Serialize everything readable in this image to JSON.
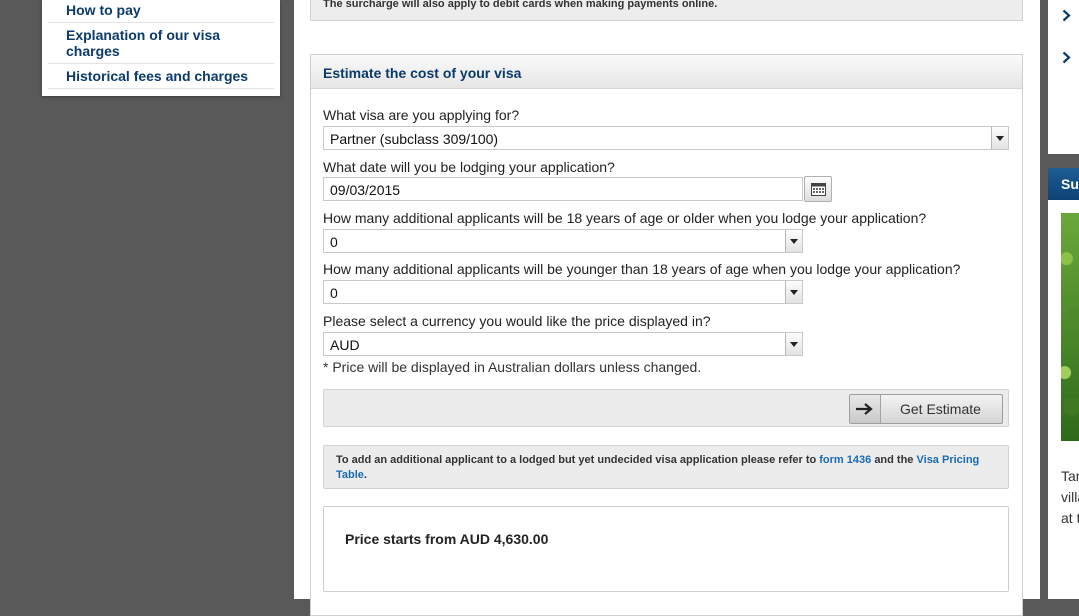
{
  "sidebar": {
    "items": [
      {
        "label": "How to pay"
      },
      {
        "label": "Explanation of our visa charges"
      },
      {
        "label": "Historical fees and charges"
      }
    ]
  },
  "notice": "The surcharge will also apply to debit cards when making payments online.",
  "estimator": {
    "title": "Estimate the cost of your visa",
    "visa_question": "What visa are you applying for?",
    "visa_value": "Partner (subclass 309/100)",
    "date_question": "What date will you be lodging your application?",
    "date_value": "09/03/2015",
    "adults_question": "How many additional applicants will be 18 years of age or older when you lodge your application?",
    "adults_value": "0",
    "children_question": "How many additional applicants will be younger than 18 years of age when you lodge your application?",
    "children_value": "0",
    "currency_question": "Please select a currency you would like the price displayed in?",
    "currency_value": "AUD",
    "currency_note": "* Price will be displayed in Australian dollars unless changed.",
    "button_label": "Get Estimate",
    "info_prefix": "To add an additional applicant to a lodged but yet undecided visa application please refer to",
    "info_link1": "form 1436",
    "info_mid": "and the",
    "info_link2": "Visa Pricing Table",
    "info_suffix": ".",
    "price_text": "Price starts from AUD 4,630.00"
  },
  "right": {
    "header": "Su",
    "text_lines": [
      "Tar",
      "villa",
      "at t"
    ]
  },
  "colors": {
    "nav_link": "#0b3a6b",
    "link": "#1b6bb5",
    "header_blue": "#0d4274",
    "page_bg": "#595959"
  }
}
